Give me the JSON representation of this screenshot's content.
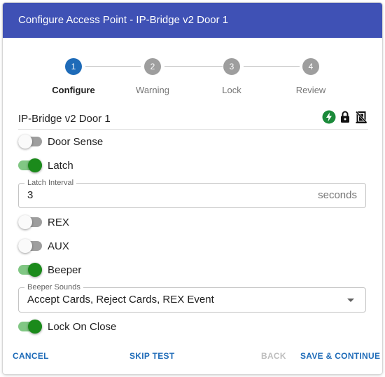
{
  "dialog": {
    "title": "Configure Access Point - IP-Bridge v2 Door 1"
  },
  "stepper": {
    "steps": [
      {
        "number": "1",
        "label": "Configure",
        "state": "active"
      },
      {
        "number": "2",
        "label": "Warning",
        "state": "inactive"
      },
      {
        "number": "3",
        "label": "Lock",
        "state": "inactive"
      },
      {
        "number": "4",
        "label": "Review",
        "state": "inactive"
      }
    ]
  },
  "door": {
    "name": "IP-Bridge v2 Door 1",
    "status_icons": [
      "power-bolt-icon",
      "lock-icon",
      "door-sensor-off-icon"
    ]
  },
  "toggles": {
    "door_sense": {
      "label": "Door Sense",
      "on": false
    },
    "latch": {
      "label": "Latch",
      "on": true
    },
    "rex": {
      "label": "REX",
      "on": false
    },
    "aux": {
      "label": "AUX",
      "on": false
    },
    "beeper": {
      "label": "Beeper",
      "on": true
    },
    "lock_on_close": {
      "label": "Lock On Close",
      "on": true
    }
  },
  "latch_interval": {
    "label": "Latch Interval",
    "value": "3",
    "suffix": "seconds"
  },
  "beeper_sounds": {
    "label": "Beeper Sounds",
    "selected": "Accept Cards, Reject Cards, REX Event"
  },
  "footer": {
    "cancel": "CANCEL",
    "skip_test": "SKIP TEST",
    "back": "BACK",
    "save_continue": "SAVE & CONTINUE"
  },
  "colors": {
    "header": "#3f51b5",
    "primary": "#1e6bb8",
    "toggle_on": "#1b8a1b",
    "bolt": "#1b8a3a"
  }
}
